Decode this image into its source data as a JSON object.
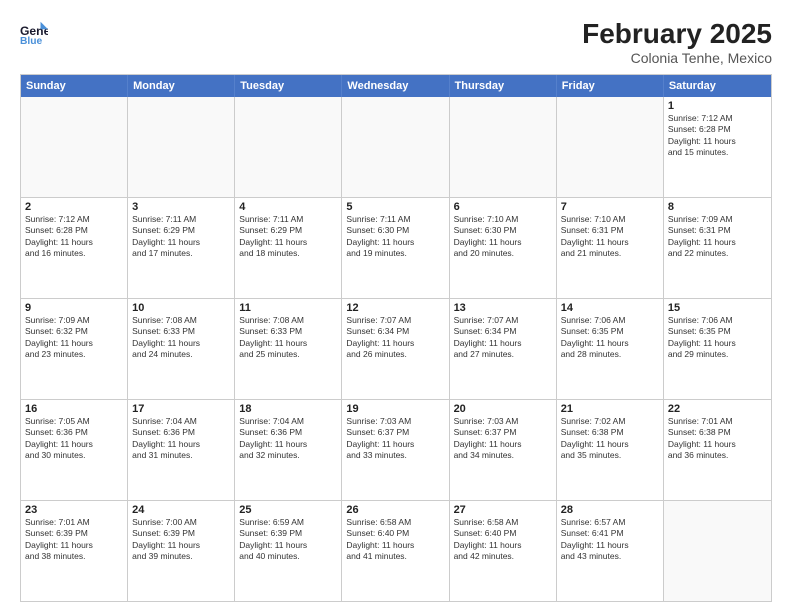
{
  "header": {
    "logo_line1": "General",
    "logo_line2": "Blue",
    "month": "February 2025",
    "location": "Colonia Tenhe, Mexico"
  },
  "day_headers": [
    "Sunday",
    "Monday",
    "Tuesday",
    "Wednesday",
    "Thursday",
    "Friday",
    "Saturday"
  ],
  "weeks": [
    [
      {
        "num": "",
        "info": ""
      },
      {
        "num": "",
        "info": ""
      },
      {
        "num": "",
        "info": ""
      },
      {
        "num": "",
        "info": ""
      },
      {
        "num": "",
        "info": ""
      },
      {
        "num": "",
        "info": ""
      },
      {
        "num": "1",
        "info": "Sunrise: 7:12 AM\nSunset: 6:28 PM\nDaylight: 11 hours\nand 15 minutes."
      }
    ],
    [
      {
        "num": "2",
        "info": "Sunrise: 7:12 AM\nSunset: 6:28 PM\nDaylight: 11 hours\nand 16 minutes."
      },
      {
        "num": "3",
        "info": "Sunrise: 7:11 AM\nSunset: 6:29 PM\nDaylight: 11 hours\nand 17 minutes."
      },
      {
        "num": "4",
        "info": "Sunrise: 7:11 AM\nSunset: 6:29 PM\nDaylight: 11 hours\nand 18 minutes."
      },
      {
        "num": "5",
        "info": "Sunrise: 7:11 AM\nSunset: 6:30 PM\nDaylight: 11 hours\nand 19 minutes."
      },
      {
        "num": "6",
        "info": "Sunrise: 7:10 AM\nSunset: 6:30 PM\nDaylight: 11 hours\nand 20 minutes."
      },
      {
        "num": "7",
        "info": "Sunrise: 7:10 AM\nSunset: 6:31 PM\nDaylight: 11 hours\nand 21 minutes."
      },
      {
        "num": "8",
        "info": "Sunrise: 7:09 AM\nSunset: 6:31 PM\nDaylight: 11 hours\nand 22 minutes."
      }
    ],
    [
      {
        "num": "9",
        "info": "Sunrise: 7:09 AM\nSunset: 6:32 PM\nDaylight: 11 hours\nand 23 minutes."
      },
      {
        "num": "10",
        "info": "Sunrise: 7:08 AM\nSunset: 6:33 PM\nDaylight: 11 hours\nand 24 minutes."
      },
      {
        "num": "11",
        "info": "Sunrise: 7:08 AM\nSunset: 6:33 PM\nDaylight: 11 hours\nand 25 minutes."
      },
      {
        "num": "12",
        "info": "Sunrise: 7:07 AM\nSunset: 6:34 PM\nDaylight: 11 hours\nand 26 minutes."
      },
      {
        "num": "13",
        "info": "Sunrise: 7:07 AM\nSunset: 6:34 PM\nDaylight: 11 hours\nand 27 minutes."
      },
      {
        "num": "14",
        "info": "Sunrise: 7:06 AM\nSunset: 6:35 PM\nDaylight: 11 hours\nand 28 minutes."
      },
      {
        "num": "15",
        "info": "Sunrise: 7:06 AM\nSunset: 6:35 PM\nDaylight: 11 hours\nand 29 minutes."
      }
    ],
    [
      {
        "num": "16",
        "info": "Sunrise: 7:05 AM\nSunset: 6:36 PM\nDaylight: 11 hours\nand 30 minutes."
      },
      {
        "num": "17",
        "info": "Sunrise: 7:04 AM\nSunset: 6:36 PM\nDaylight: 11 hours\nand 31 minutes."
      },
      {
        "num": "18",
        "info": "Sunrise: 7:04 AM\nSunset: 6:36 PM\nDaylight: 11 hours\nand 32 minutes."
      },
      {
        "num": "19",
        "info": "Sunrise: 7:03 AM\nSunset: 6:37 PM\nDaylight: 11 hours\nand 33 minutes."
      },
      {
        "num": "20",
        "info": "Sunrise: 7:03 AM\nSunset: 6:37 PM\nDaylight: 11 hours\nand 34 minutes."
      },
      {
        "num": "21",
        "info": "Sunrise: 7:02 AM\nSunset: 6:38 PM\nDaylight: 11 hours\nand 35 minutes."
      },
      {
        "num": "22",
        "info": "Sunrise: 7:01 AM\nSunset: 6:38 PM\nDaylight: 11 hours\nand 36 minutes."
      }
    ],
    [
      {
        "num": "23",
        "info": "Sunrise: 7:01 AM\nSunset: 6:39 PM\nDaylight: 11 hours\nand 38 minutes."
      },
      {
        "num": "24",
        "info": "Sunrise: 7:00 AM\nSunset: 6:39 PM\nDaylight: 11 hours\nand 39 minutes."
      },
      {
        "num": "25",
        "info": "Sunrise: 6:59 AM\nSunset: 6:39 PM\nDaylight: 11 hours\nand 40 minutes."
      },
      {
        "num": "26",
        "info": "Sunrise: 6:58 AM\nSunset: 6:40 PM\nDaylight: 11 hours\nand 41 minutes."
      },
      {
        "num": "27",
        "info": "Sunrise: 6:58 AM\nSunset: 6:40 PM\nDaylight: 11 hours\nand 42 minutes."
      },
      {
        "num": "28",
        "info": "Sunrise: 6:57 AM\nSunset: 6:41 PM\nDaylight: 11 hours\nand 43 minutes."
      },
      {
        "num": "",
        "info": ""
      }
    ]
  ]
}
